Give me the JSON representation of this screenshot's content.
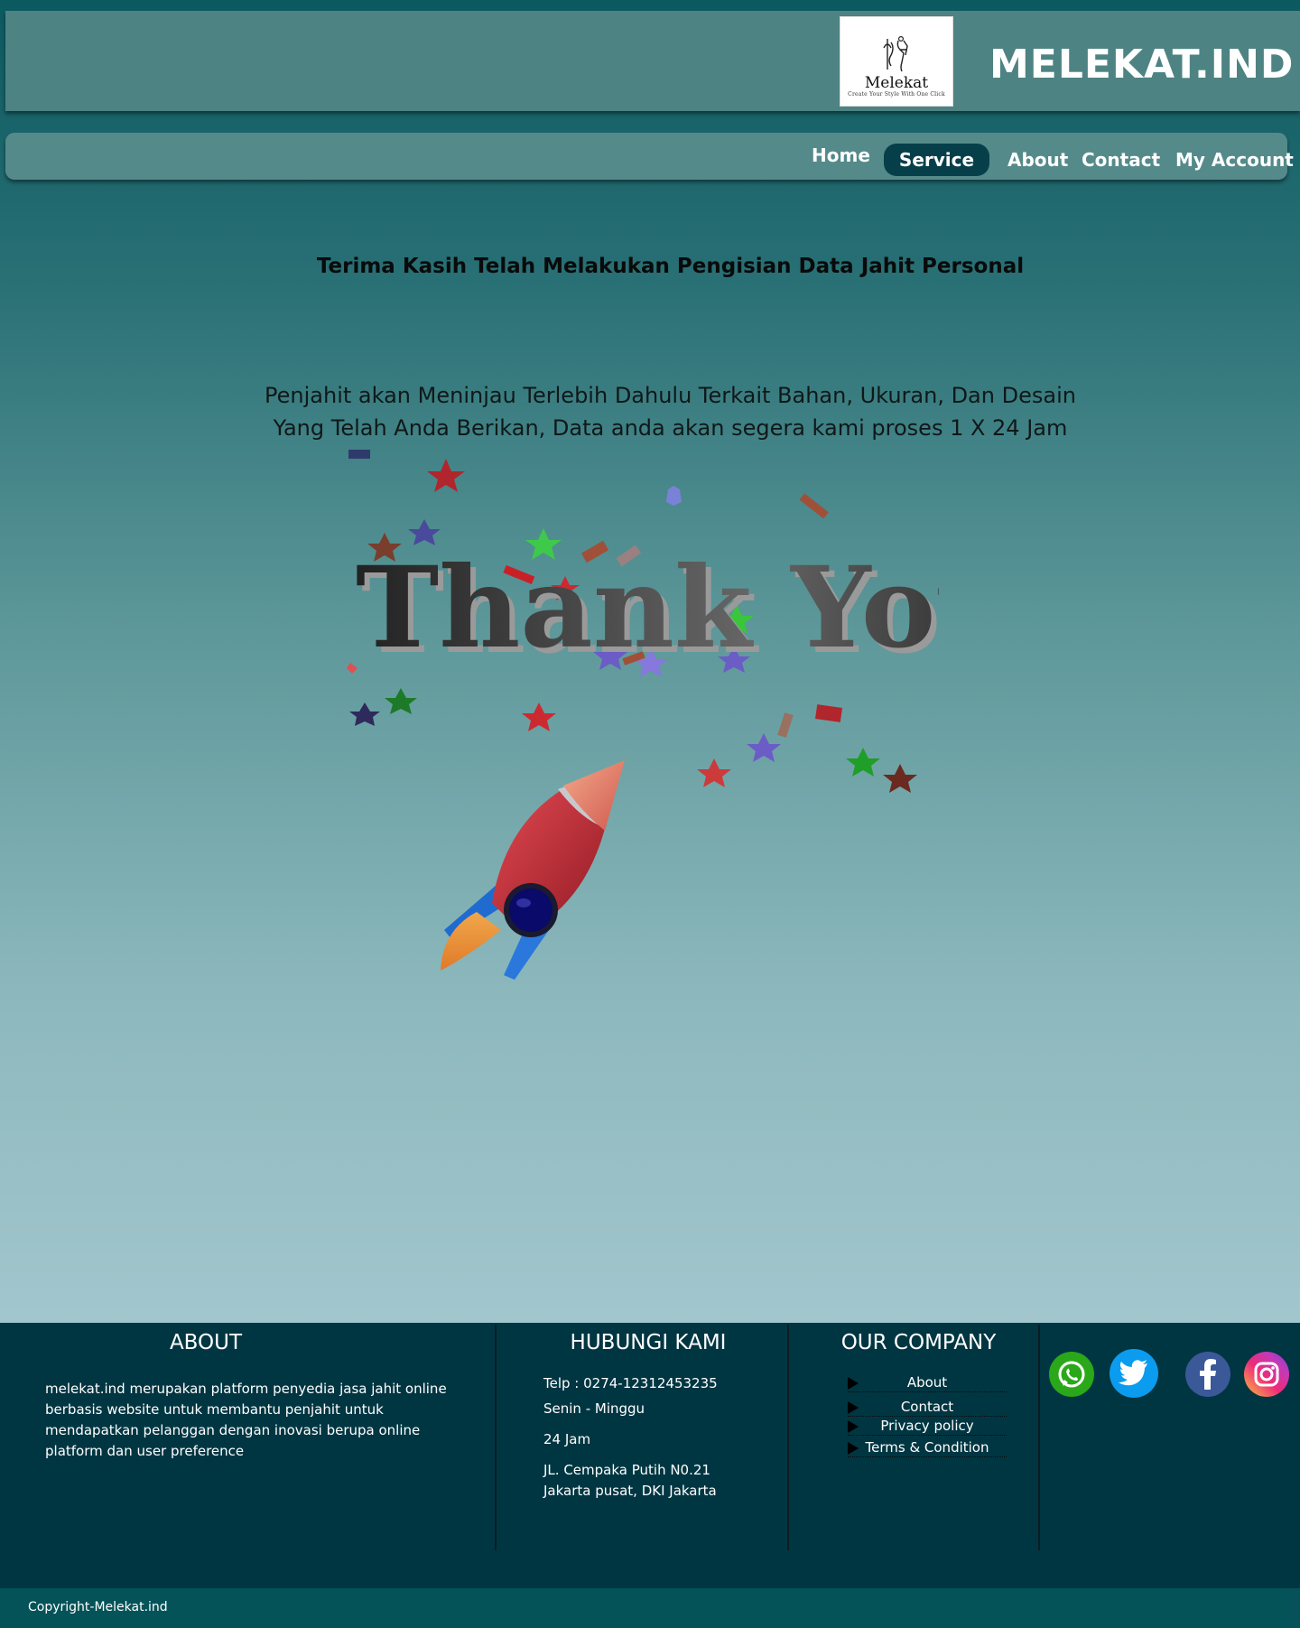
{
  "header": {
    "logo_name": "Melekat",
    "logo_tagline": "Create Your Style With One Click",
    "brand_title": "MELEKAT.IND"
  },
  "nav": {
    "items": [
      {
        "label": "Home"
      },
      {
        "label": "Service",
        "active": true
      },
      {
        "label": "About"
      },
      {
        "label": "Contact"
      },
      {
        "label": "My Account"
      }
    ]
  },
  "main": {
    "heading": "Terima Kasih Telah Melakukan Pengisian Data Jahit Personal",
    "description": "Penjahit akan Meninjau Terlebih Dahulu Terkait Bahan, Ukuran, Dan Desain Yang Telah Anda Berikan, Data anda akan segera kami proses 1 X 24 Jam",
    "hero_text": "Thank You"
  },
  "footer": {
    "about": {
      "title": "ABOUT",
      "text": "melekat.ind merupakan platform penyedia jasa jahit online berbasis website untuk membantu penjahit untuk mendapatkan pelanggan dengan inovasi berupa online platform dan user preference"
    },
    "contact": {
      "title": "HUBUNGI KAMI",
      "phone": "Telp  :  0274-12312453235",
      "days": "Senin - Minggu",
      "hours": "24 Jam",
      "address_line1": "JL. Cempaka Putih N0.21",
      "address_line2": "Jakarta pusat, DKI Jakarta"
    },
    "company": {
      "title": "OUR COMPANY",
      "links": [
        {
          "label": "About"
        },
        {
          "label": "Contact"
        },
        {
          "label": "Privacy policy"
        },
        {
          "label": "Terms & Condition"
        }
      ]
    },
    "social": [
      {
        "icon": "whatsapp-icon",
        "color": "#2aa81a"
      },
      {
        "icon": "twitter-icon",
        "color": "#0b9cef"
      },
      {
        "icon": "facebook-icon",
        "color": "#3b5898"
      },
      {
        "icon": "instagram-icon",
        "color": "#ee2a7b"
      }
    ],
    "copyright": "Copyright-Melekat.ind"
  },
  "colors": {
    "header_bg": "#4e8383",
    "nav_bg": "#558a8a",
    "nav_active": "#063f49",
    "footer_bg": "#003642",
    "copyright_bg": "#045359"
  }
}
